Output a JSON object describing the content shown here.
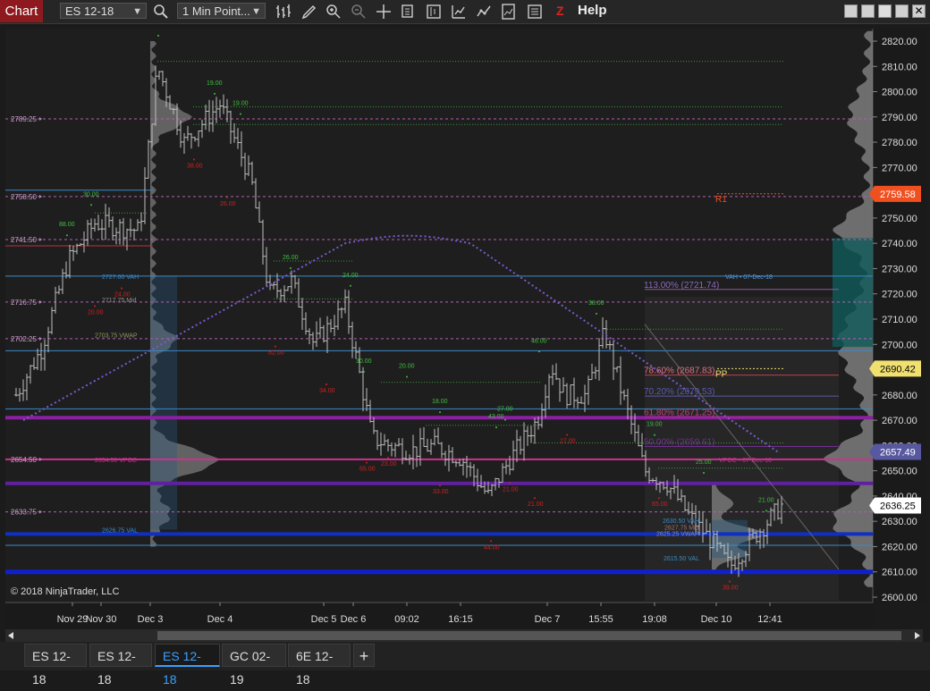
{
  "toolbar": {
    "chart_label": "Chart",
    "instrument": "ES 12-18",
    "interval": "1 Min Point...",
    "help_label": "Help",
    "icons": [
      "search-icon",
      "bar-type-icon",
      "draw-icon",
      "zoom-in-icon",
      "zoom-out-icon",
      "crosshair-icon",
      "data-box-icon",
      "chart-style-icon",
      "indicators-icon",
      "strategies-icon",
      "templates-icon",
      "properties-icon",
      "z-icon"
    ]
  },
  "chart_data": {
    "type": "candlestick",
    "instrument": "ES 12-18",
    "ylim": [
      2596,
      2824
    ],
    "y_ticks": [
      2600,
      2610,
      2620,
      2630,
      2640,
      2650,
      2660,
      2670,
      2680,
      2690,
      2700,
      2710,
      2720,
      2730,
      2740,
      2750,
      2760,
      2770,
      2780,
      2790,
      2800,
      2810,
      2820
    ],
    "x_labels": [
      "Nov 29",
      "Nov 30",
      "Dec 3",
      "Dec 4",
      "Dec 5",
      "Dec 6",
      "09:02",
      "16:15",
      "Dec 7",
      "15:55",
      "19:08",
      "Dec 10",
      "12:41"
    ],
    "price_tags": [
      {
        "value": "2759.58",
        "color": "#f05020"
      },
      {
        "value": "2690.42",
        "color": "#f0e070"
      },
      {
        "value": "2657.49",
        "color": "#5858a0"
      },
      {
        "value": "2636.25",
        "color": "#ffffff"
      }
    ],
    "left_price_labels": [
      "2789.25",
      "2758.50",
      "2741.50",
      "2716.75",
      "2702.25",
      "2654.50",
      "2633.75"
    ],
    "profile_labels": [
      "2727.00 VAH",
      "2717.75 Mid",
      "2703.75 VWAP",
      "2654.50 VPOC",
      "2626.75 VAL",
      "2630.50 VAH",
      "2627.75 Mid",
      "2625.25 VWAP",
      "2615.50 VAL"
    ],
    "fib_labels": [
      "113.00% (2721.74)",
      "78.60% (2687.83)",
      "70.20% (2679.53)",
      "61.80% (2671.25)",
      "50.00% (2659.61)"
    ],
    "pivot_labels": [
      "R1",
      "PP"
    ],
    "annotation": "VAH • 07-Dec-18",
    "annotation2": "VPOC • 07-Dec-18",
    "swing_high_labels": [
      "83.00",
      "19.00",
      "19.00",
      "30.00",
      "88.00",
      "26.00",
      "24.00",
      "30.00",
      "20.00",
      "18.00",
      "27.00",
      "43.00",
      "46.00",
      "38.00",
      "19.00",
      "25.00",
      "21.00"
    ],
    "swing_low_labels": [
      "38.00",
      "26.00",
      "24.00",
      "20.00",
      "62.00",
      "34.00",
      "65.00",
      "23.00",
      "33.00",
      "21.00",
      "21.00",
      "44.00",
      "27.00",
      "65.00",
      "39.00"
    ],
    "copyright": "© 2018 NinjaTrader, LLC"
  },
  "tabs": [
    {
      "label": "ES 12-18",
      "active": false
    },
    {
      "label": "ES 12-18",
      "active": false
    },
    {
      "label": "ES 12-18",
      "active": true
    },
    {
      "label": "GC 02-19",
      "active": false
    },
    {
      "label": "6E 12-18",
      "active": false
    }
  ],
  "add_tab_label": "+"
}
